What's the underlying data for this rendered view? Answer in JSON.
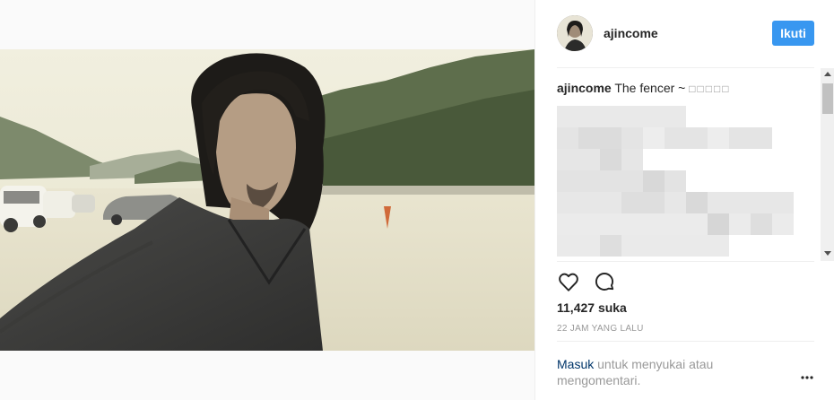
{
  "post": {
    "username": "ajincome",
    "follow_label": "Ikuti",
    "caption_user": "ajincome",
    "caption_text": "The fencer ~",
    "caption_tail": "□□□□□",
    "likes": "11,427 suka",
    "timestamp": "22 JAM YANG LALU"
  },
  "login_prompt": {
    "link": "Masuk",
    "text": "untuk menyukai atau mengomentari."
  },
  "icons": {
    "like": "heart-icon",
    "comment": "comment-bubble-icon",
    "more": "more-options-icon"
  },
  "colors": {
    "follow_button": "#3897f0",
    "login_link": "#003569",
    "muted_text": "#999999"
  }
}
